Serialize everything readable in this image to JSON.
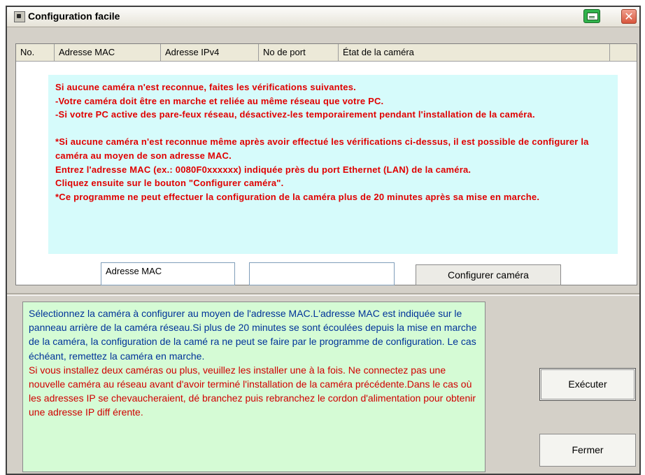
{
  "window": {
    "title": "Configuration facile"
  },
  "list": {
    "columns": [
      "No.",
      "Adresse MAC",
      "Adresse IPv4",
      "No de port",
      "État de la caméra"
    ]
  },
  "info": {
    "lines": [
      "Si aucune caméra n'est reconnue, faites les vérifications suivantes.",
      "-Votre caméra doit être en marche et reliée au même réseau que votre PC.",
      "-Si votre PC active des pare-feux réseau, désactivez-les temporairement pendant l'installation de la caméra.",
      "",
      "*Si aucune caméra n'est reconnue même après avoir effectué les vérifications ci-dessus, il est possible de configurer la caméra au moyen de son adresse MAC.",
      "Entrez l'adresse MAC (ex.: 0080F0xxxxxx) indiquée près du port Ethernet (LAN) de la caméra.",
      "Cliquez ensuite sur le bouton \"Configurer caméra\".",
      "*Ce programme ne peut effectuer la configuration de la caméra plus de 20 minutes après sa mise en marche."
    ]
  },
  "mac": {
    "label": "Adresse MAC",
    "input_value": "",
    "configure_button": "Configurer caméra"
  },
  "help": {
    "blue_text": "Sélectionnez la caméra à configurer au moyen de l'adresse MAC.L'adresse MAC est indiquée sur le panneau arrière de la caméra réseau.Si plus de 20 minutes se sont écoulées depuis la mise en marche de la caméra, la configuration de la camé ra ne peut se faire par le programme de configuration.  Le cas échéant, remettez la caméra en marche.",
    "red_text": "Si vous installez deux caméras ou plus, veuillez les installer une à la fois. Ne connectez pas une nouvelle caméra au réseau avant d'avoir terminé l'installation de la caméra précédente.Dans le cas où les adresses IP se chevaucheraient, dé branchez puis rebranchez le cordon d'alimentation pour obtenir une adresse IP diff érente."
  },
  "buttons": {
    "execute": "Exécuter",
    "close": "Fermer"
  },
  "icons": {
    "system": "window-system-icon",
    "printer": "printer-icon",
    "close": "close-icon"
  },
  "colors": {
    "info_background": "#d6fbfb",
    "info_text": "#e00000",
    "help_background": "#d5fbd5",
    "help_blue": "#003399",
    "help_red": "#d00000"
  }
}
